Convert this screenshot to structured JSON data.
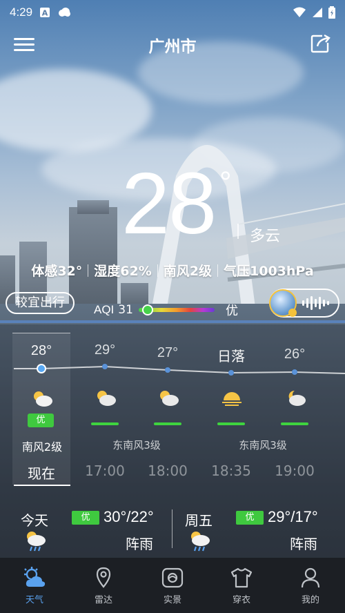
{
  "status_bar": {
    "time": "4:29",
    "icons": [
      "a-notification-icon",
      "cloud-notification-icon",
      "wifi-icon",
      "signal-icon",
      "battery-icon"
    ]
  },
  "header": {
    "city": "广州市",
    "menu_icon": "menu-icon",
    "share_icon": "share-icon"
  },
  "current": {
    "temperature": "28",
    "degree": "°",
    "condition": "多云",
    "details": [
      "体感32°",
      "湿度62%",
      "南风2级",
      "气压1003hPa"
    ]
  },
  "air": {
    "travel_label": "较宜出行",
    "aqi_label": "AQI",
    "aqi_value": "31",
    "aqi_level_fraction": 0.05,
    "aqi_grade": "优"
  },
  "hourly": {
    "items": [
      {
        "temp": "28°",
        "time": "现在",
        "icon": "partly-cloudy-day-icon",
        "air_label": "优",
        "is_now": true
      },
      {
        "temp": "29°",
        "time": "17:00",
        "icon": "partly-cloudy-day-icon",
        "air_label": ""
      },
      {
        "temp": "27°",
        "time": "18:00",
        "icon": "partly-cloudy-day-icon",
        "air_label": ""
      },
      {
        "temp": "日落",
        "time": "18:35",
        "icon": "sunset-icon",
        "air_label": ""
      },
      {
        "temp": "26°",
        "time": "19:00",
        "icon": "partly-cloudy-night-icon",
        "air_label": ""
      }
    ],
    "wind": [
      "南风2级",
      "东南风3级",
      "东南风3级"
    ]
  },
  "daily": [
    {
      "day": "今天",
      "air_label": "优",
      "temp": "30°/22°",
      "condition": "阵雨",
      "icon": "shower-icon"
    },
    {
      "day": "周五",
      "air_label": "优",
      "temp": "29°/17°",
      "condition": "阵雨",
      "icon": "shower-icon"
    }
  ],
  "nav": [
    {
      "label": "天气",
      "icon": "weather-icon",
      "active": true
    },
    {
      "label": "雷达",
      "icon": "radar-pin-icon",
      "active": false
    },
    {
      "label": "实景",
      "icon": "photo-icon",
      "active": false
    },
    {
      "label": "穿衣",
      "icon": "shirt-icon",
      "active": false
    },
    {
      "label": "我的",
      "icon": "profile-icon",
      "active": false
    }
  ],
  "colors": {
    "accent": "#5aa2ef",
    "air_good": "#3fc93f"
  }
}
